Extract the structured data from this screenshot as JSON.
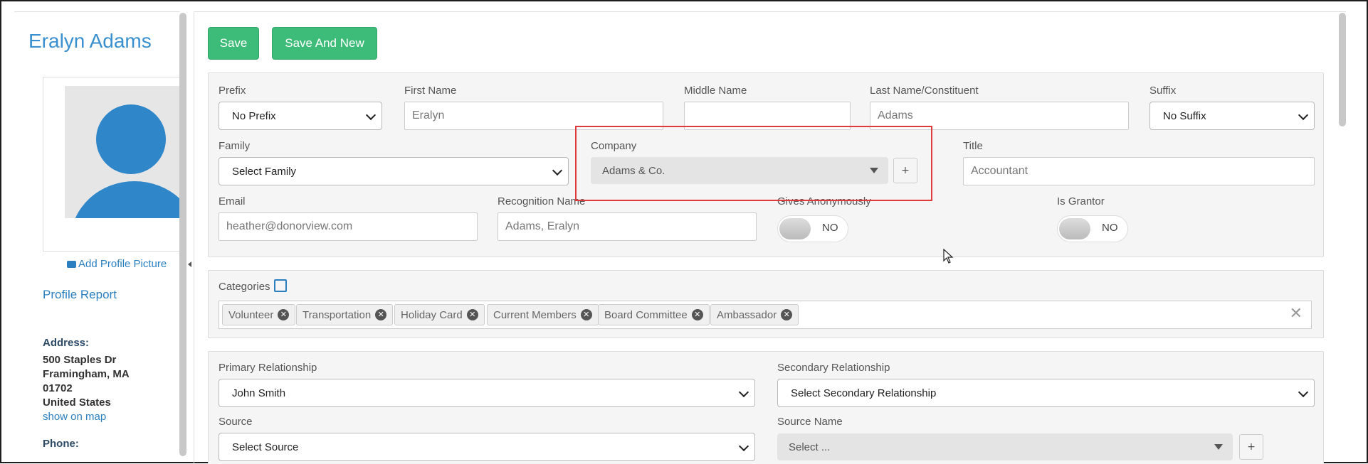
{
  "contact": {
    "name": "Eralyn Adams"
  },
  "sidebar": {
    "add_picture": "Add Profile Picture",
    "profile_report": "Profile Report",
    "address_label": "Address:",
    "address_lines": [
      "500 Staples Dr",
      "Framingham, MA",
      "01702",
      "United States"
    ],
    "map_link": "show on map",
    "phone_label": "Phone:"
  },
  "toolbar": {
    "save_label": "Save",
    "save_new_label": "Save And New"
  },
  "form": {
    "prefix": {
      "label": "Prefix",
      "value": "No Prefix"
    },
    "first_name": {
      "label": "First Name",
      "value": "Eralyn"
    },
    "middle_name": {
      "label": "Middle Name",
      "value": ""
    },
    "last_name": {
      "label": "Last Name/Constituent",
      "value": "Adams"
    },
    "suffix": {
      "label": "Suffix",
      "value": "No Suffix"
    },
    "family": {
      "label": "Family",
      "value": "Select Family"
    },
    "company": {
      "label": "Company",
      "value": "Adams & Co.",
      "add": "+"
    },
    "title": {
      "label": "Title",
      "value": "Accountant"
    },
    "email": {
      "label": "Email",
      "value": "heather@donorview.com"
    },
    "recognition_name": {
      "label": "Recognition Name",
      "value": "Adams, Eralyn"
    },
    "gives_anonymously": {
      "label": "Gives Anonymously",
      "value": "NO"
    },
    "is_grantor": {
      "label": "Is Grantor",
      "value": "NO"
    }
  },
  "categories": {
    "label": "Categories",
    "tags": [
      "Volunteer",
      "Transportation",
      "Holiday Card",
      "Current Members",
      "Board Committee",
      "Ambassador"
    ]
  },
  "relationships": {
    "primary": {
      "label": "Primary Relationship",
      "value": "John Smith"
    },
    "secondary": {
      "label": "Secondary Relationship",
      "value": "Select Secondary Relationship"
    },
    "source": {
      "label": "Source",
      "value": "Select Source"
    },
    "source_name": {
      "label": "Source Name",
      "value": "Select ...",
      "add": "+"
    }
  },
  "colors": {
    "accent": "#3dbb78",
    "link": "#2a7fc0",
    "avatar": "#2f86c8",
    "highlight": "#e03a3a"
  }
}
